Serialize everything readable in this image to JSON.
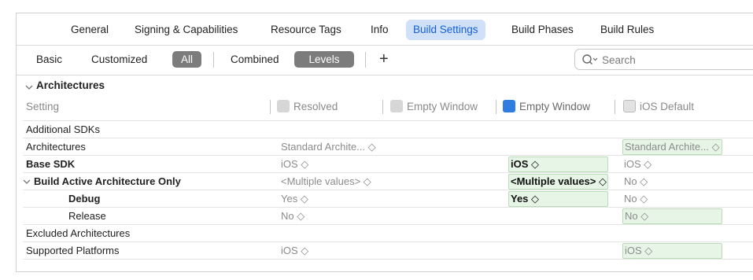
{
  "tabs": [
    {
      "label": "General"
    },
    {
      "label": "Signing & Capabilities"
    },
    {
      "label": "Resource Tags"
    },
    {
      "label": "Info"
    },
    {
      "label": "Build Settings"
    },
    {
      "label": "Build Phases"
    },
    {
      "label": "Build Rules"
    }
  ],
  "filter": {
    "basic": "Basic",
    "customized": "Customized",
    "all": "All",
    "combined": "Combined",
    "levels": "Levels",
    "plus": "+",
    "search_placeholder": "Search"
  },
  "section": {
    "title": "Architectures",
    "columns": {
      "setting": "Setting",
      "resolved": "Resolved",
      "empty_window_1": "Empty Window",
      "empty_window_2": "Empty Window",
      "ios_default": "iOS Default"
    }
  },
  "rows": [
    {
      "name": "Additional SDKs",
      "resolved": "",
      "target": "",
      "project": "",
      "ios_default": ""
    },
    {
      "name": "Architectures",
      "resolved": "Standard Archite... ◇",
      "target": "",
      "project": "",
      "ios_default": "Standard Archite... ◇"
    },
    {
      "name": "Base SDK",
      "resolved": "iOS ◇",
      "target": "",
      "project": "iOS ◇",
      "ios_default": "iOS ◇"
    },
    {
      "name": "Build Active Architecture Only",
      "resolved": "<Multiple values> ◇",
      "target": "",
      "project": "<Multiple values> ◇",
      "ios_default": "No ◇"
    },
    {
      "name": "Debug",
      "resolved": "Yes ◇",
      "target": "",
      "project": "Yes ◇",
      "ios_default": "No ◇"
    },
    {
      "name": "Release",
      "resolved": "No ◇",
      "target": "",
      "project": "",
      "ios_default": "No ◇"
    },
    {
      "name": "Excluded Architectures",
      "resolved": "",
      "target": "",
      "project": "",
      "ios_default": ""
    },
    {
      "name": "Supported Platforms",
      "resolved": "iOS ◇",
      "target": "",
      "project": "",
      "ios_default": "iOS ◇"
    }
  ],
  "colors": {
    "accent": "#1560d6",
    "tab_active_bg": "#cfe0f7",
    "pill_bg": "#7c7c7c",
    "value_box_bg": "#e7f5e7",
    "value_box_border": "#b9dcb9"
  }
}
